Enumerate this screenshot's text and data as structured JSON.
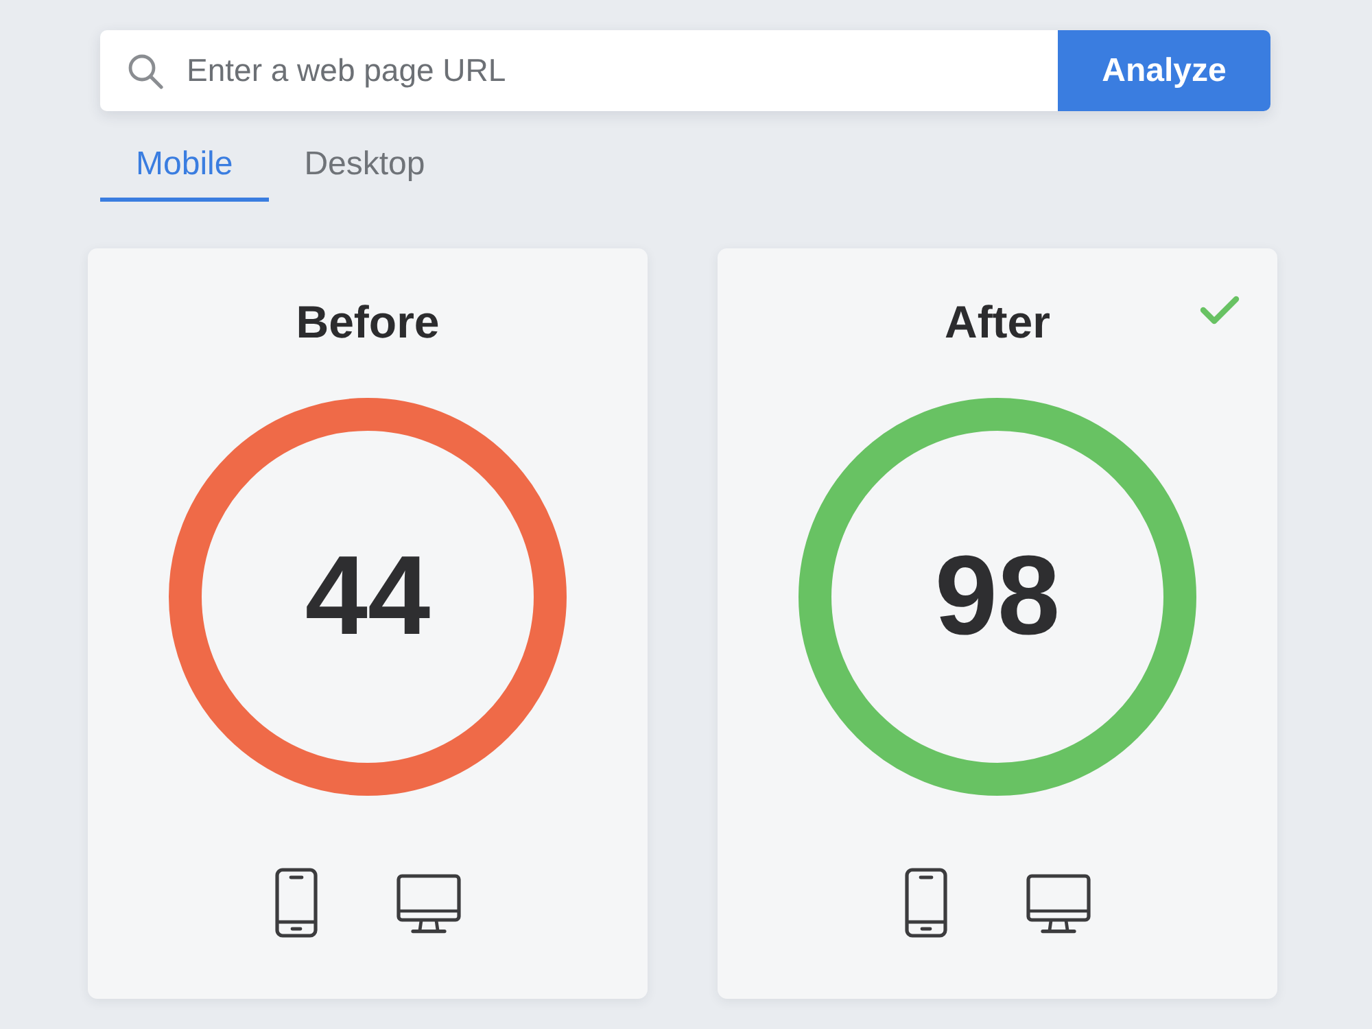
{
  "search": {
    "placeholder": "Enter a web page URL",
    "button": "Analyze"
  },
  "tabs": [
    {
      "label": "Mobile",
      "selected": true
    },
    {
      "label": "Desktop",
      "selected": false
    }
  ],
  "cards": [
    {
      "title": "Before",
      "score": "44",
      "color": "#ef6a48",
      "verified": false
    },
    {
      "title": "After",
      "score": "98",
      "color": "#68c263",
      "verified": true
    }
  ]
}
